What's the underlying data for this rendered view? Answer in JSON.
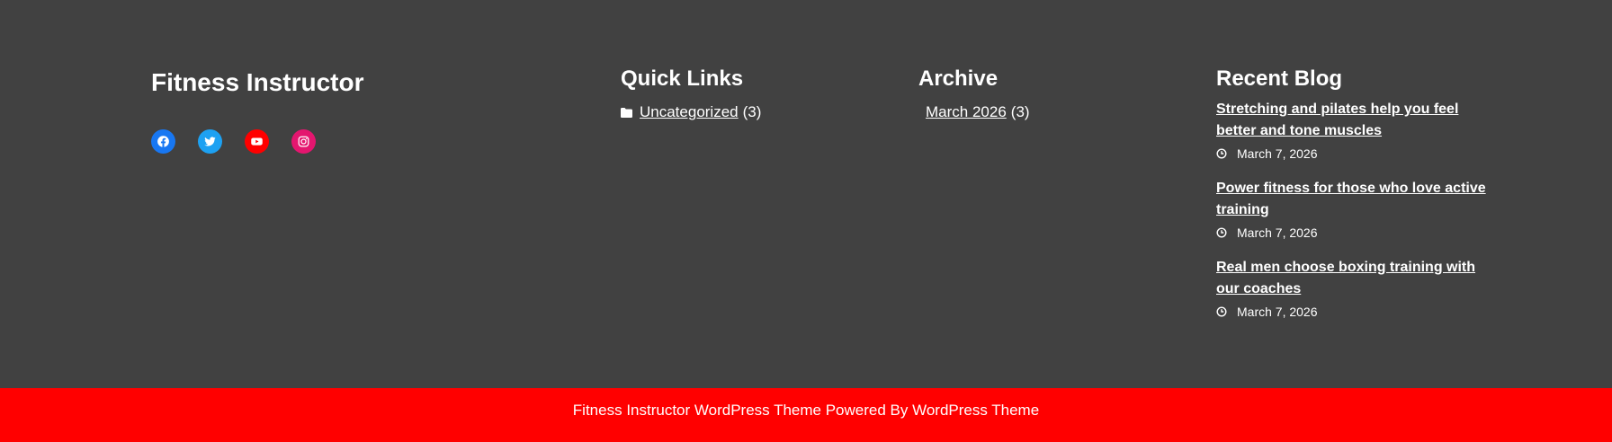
{
  "brand": {
    "title": "Fitness Instructor",
    "socials": [
      {
        "name": "facebook-icon",
        "color": "#1877f2"
      },
      {
        "name": "twitter-icon",
        "color": "#1da1f2"
      },
      {
        "name": "youtube-icon",
        "color": "#ff0000"
      },
      {
        "name": "instagram-icon",
        "color": "#e4166f"
      }
    ]
  },
  "quick_links": {
    "title": "Quick Links",
    "items": [
      {
        "label": "Uncategorized",
        "count": "(3)",
        "icon": "folder-icon"
      }
    ]
  },
  "archive": {
    "title": "Archive",
    "items": [
      {
        "label": "March 2026",
        "count": "(3)"
      }
    ]
  },
  "recent_blog": {
    "title": "Recent Blog",
    "posts": [
      {
        "title": "Stretching and pilates help you feel better and tone muscles",
        "date": "March 7, 2026",
        "icon": "clock-icon"
      },
      {
        "title": "Power fitness for those who love active training",
        "date": "March 7, 2026",
        "icon": "clock-icon"
      },
      {
        "title": "Real men choose boxing training with our coaches",
        "date": "March 7, 2026",
        "icon": "clock-icon"
      }
    ]
  },
  "copyright": {
    "text": "Fitness Instructor WordPress Theme Powered By WordPress Theme"
  },
  "colors": {
    "footer_bg": "#414141",
    "bottom_bar_bg": "#ff0000",
    "text": "#ffffff"
  }
}
